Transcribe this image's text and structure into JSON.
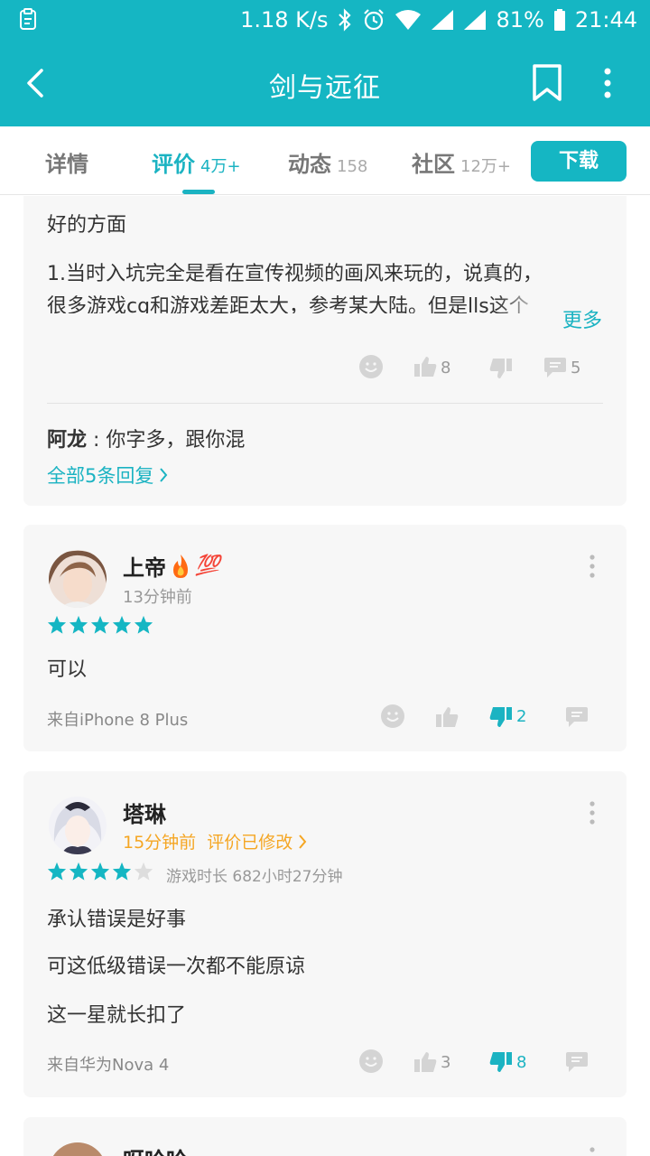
{
  "status_bar": {
    "speed": "1.18 K/s",
    "battery": "81%",
    "time": "21:44"
  },
  "app_bar": {
    "title": "剑与远征"
  },
  "tabs": [
    {
      "label": "详情",
      "count": ""
    },
    {
      "label": "评价",
      "count": "4万+"
    },
    {
      "label": "动态",
      "count": "158"
    },
    {
      "label": "社区",
      "count": "12万+"
    }
  ],
  "download_label": "下载",
  "review1": {
    "section_heading": "好的方面",
    "body_line1": "1.当时入坑完全是看在宣传视频的画风来玩的，说真的，",
    "body_line2": "很多游戏cg和游戏差距太大，参考某大陆。但是lls这个",
    "more_label": "更多",
    "likes": "8",
    "comments": "5",
    "reply_author": "阿龙",
    "reply_sep": " : ",
    "reply_text": "你字多，跟你混",
    "all_replies": "全部5条回复"
  },
  "review2": {
    "username": "上帝",
    "badge": "💯",
    "time": "13分钟前",
    "rating": 5,
    "body": "可以",
    "device": "来自iPhone 8 Plus",
    "dislikes": "2"
  },
  "review3": {
    "username": "塔琳",
    "time_edit": "15分钟前  评价已修改",
    "rating": 4,
    "playtime": "游戏时长 682小时27分钟",
    "lines": [
      "承认错误是好事",
      "可这低级错误一次都不能原谅",
      "这一星就长扣了"
    ],
    "device": "来自华为Nova 4",
    "likes": "3",
    "dislikes": "8"
  },
  "review4": {
    "username": "呀哈哈"
  },
  "colors": {
    "accent": "#15b6c3",
    "edit_orange": "#f5a623",
    "star_off": "#dddddd"
  }
}
